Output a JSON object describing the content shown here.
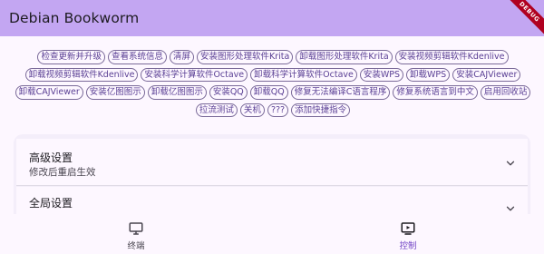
{
  "app": {
    "title": "Debian Bookworm",
    "debug_label": "DEBUG"
  },
  "commands": [
    "检查更新并升级",
    "查看系统信息",
    "清屏",
    "安装图形处理软件Krita",
    "卸载图形处理软件Krita",
    "安装视频剪辑软件Kdenlive",
    "卸载视频剪辑软件Kdenlive",
    "安装科学计算软件Octave",
    "卸载科学计算软件Octave",
    "安装WPS",
    "卸载WPS",
    "安装CAJViewer",
    "卸载CAJViewer",
    "安装亿图图示",
    "卸载亿图图示",
    "安装QQ",
    "卸载QQ",
    "修复无法编译C语言程序",
    "修复系统语言到中文",
    "启用回收站",
    "拉流测试",
    "关机",
    "???",
    "添加快捷指令"
  ],
  "settings": {
    "advanced": {
      "title": "高级设置",
      "subtitle": "修改后重启生效",
      "icon": "chevron-down-icon"
    },
    "global": {
      "title": "全局设置",
      "icon": "chevron-down-icon"
    }
  },
  "nav": {
    "terminal": {
      "label": "终端",
      "icon": "desktop-icon"
    },
    "control": {
      "label": "控制",
      "icon": "control-screen-icon",
      "active": true
    }
  },
  "colors": {
    "appbar": "#c3a6f2",
    "accent": "#7042c4",
    "chip_text": "#5a3f94",
    "background": "#fdf7ff"
  }
}
